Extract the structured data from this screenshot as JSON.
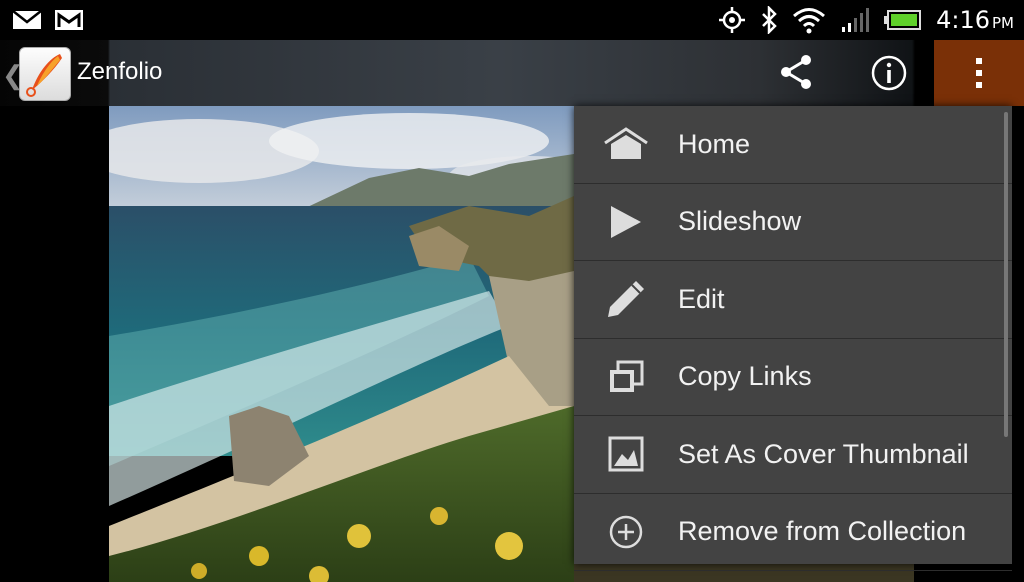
{
  "status_bar": {
    "time": "4:16",
    "ampm": "PM",
    "icons": [
      "email-icon",
      "gmail-icon",
      "gps-icon",
      "bluetooth-icon",
      "wifi-icon",
      "signal-icon",
      "battery-icon"
    ]
  },
  "action_bar": {
    "title": "Zenfolio",
    "back_glyph": "❮",
    "icons": [
      "share-icon",
      "info-icon",
      "overflow-menu-icon"
    ],
    "overflow_color": "#7a3007"
  },
  "menu": {
    "items": [
      {
        "label": "Home",
        "icon": "home-icon"
      },
      {
        "label": "Slideshow",
        "icon": "play-icon"
      },
      {
        "label": "Edit",
        "icon": "pencil-icon"
      },
      {
        "label": "Copy Links",
        "icon": "copy-links-icon"
      },
      {
        "label": "Set As Cover Thumbnail",
        "icon": "image-icon"
      },
      {
        "label": "Remove from Collection",
        "icon": "add-circle-icon"
      }
    ]
  }
}
